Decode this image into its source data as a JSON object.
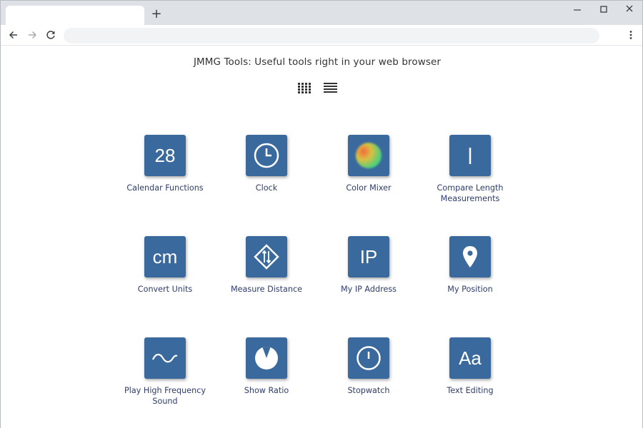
{
  "browser": {
    "new_tab_symbol": "+",
    "address_value": "",
    "address_placeholder": ""
  },
  "page": {
    "title": "JMMG Tools: Useful tools right in your web browser"
  },
  "tools": [
    {
      "label": "Calendar Functions",
      "icon": "calendar-28-icon",
      "icon_text": "28"
    },
    {
      "label": "Clock",
      "icon": "clock-icon"
    },
    {
      "label": "Color Mixer",
      "icon": "color-mixer-icon"
    },
    {
      "label": "Compare Length Measurements",
      "icon": "length-bar-icon"
    },
    {
      "label": "Convert Units",
      "icon": "cm-icon",
      "icon_text": "cm"
    },
    {
      "label": "Measure Distance",
      "icon": "measure-distance-icon"
    },
    {
      "label": "My IP Address",
      "icon": "ip-icon",
      "icon_text": "IP"
    },
    {
      "label": "My Position",
      "icon": "location-pin-icon"
    },
    {
      "label": "Play High Frequency Sound",
      "icon": "sine-wave-icon"
    },
    {
      "label": "Show Ratio",
      "icon": "pie-ratio-icon"
    },
    {
      "label": "Stopwatch",
      "icon": "stopwatch-icon"
    },
    {
      "label": "Text Editing",
      "icon": "text-aa-icon",
      "icon_text": "Aa"
    }
  ],
  "colors": {
    "tile": "#3a6a9d",
    "label": "#2e3d6b",
    "tabstrip": "#dee1e6"
  }
}
